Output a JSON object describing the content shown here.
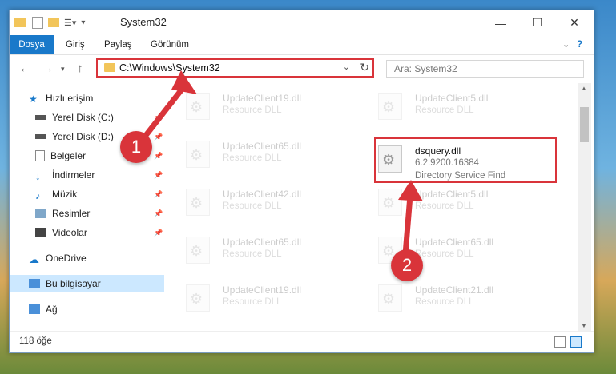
{
  "window": {
    "title": "System32"
  },
  "ribbon": {
    "tabs": [
      "Dosya",
      "Giriş",
      "Paylaş",
      "Görünüm"
    ]
  },
  "address": {
    "path": "C:\\Windows\\System32"
  },
  "search": {
    "placeholder": "Ara: System32"
  },
  "sidebar": {
    "items": [
      {
        "label": "Hızlı erişim",
        "icon": "star-icon"
      },
      {
        "label": "Yerel Disk (C:)",
        "icon": "drive-icon"
      },
      {
        "label": "Yerel Disk (D:)",
        "icon": "drive-icon"
      },
      {
        "label": "Belgeler",
        "icon": "document-icon"
      },
      {
        "label": "İndirmeler",
        "icon": "download-icon"
      },
      {
        "label": "Müzik",
        "icon": "music-icon"
      },
      {
        "label": "Resimler",
        "icon": "pictures-icon"
      },
      {
        "label": "Videolar",
        "icon": "video-icon"
      },
      {
        "label": "OneDrive",
        "icon": "cloud-icon"
      },
      {
        "label": "Bu bilgisayar",
        "icon": "computer-icon"
      },
      {
        "label": "Ağ",
        "icon": "network-icon"
      }
    ]
  },
  "files": [
    {
      "name": "UpdateClient19.dll",
      "sub": "Resource DLL"
    },
    {
      "name": "UpdateClient5.dll",
      "sub": "Resource DLL"
    },
    {
      "name": "UpdateClient65.dll",
      "sub": "Resource DLL"
    },
    {
      "name": "dsquery.dll",
      "sub": "6.2.9200.16384",
      "desc": "Directory Service Find"
    },
    {
      "name": "UpdateClient42.dll",
      "sub": "Resource DLL"
    },
    {
      "name": "UpdateClient5.dll",
      "sub": "Resource DLL"
    },
    {
      "name": "UpdateClient65.dll",
      "sub": "Resource DLL"
    },
    {
      "name": "UpdateClient65.dll",
      "sub": "Resource DLL"
    },
    {
      "name": "UpdateClient19.dll",
      "sub": "Resource DLL"
    },
    {
      "name": "UpdateClient21.dll",
      "sub": "Resource DLL"
    }
  ],
  "status": {
    "count": "118 öğe"
  },
  "annotations": {
    "step1": "1",
    "step2": "2",
    "color": "#d9343a"
  }
}
